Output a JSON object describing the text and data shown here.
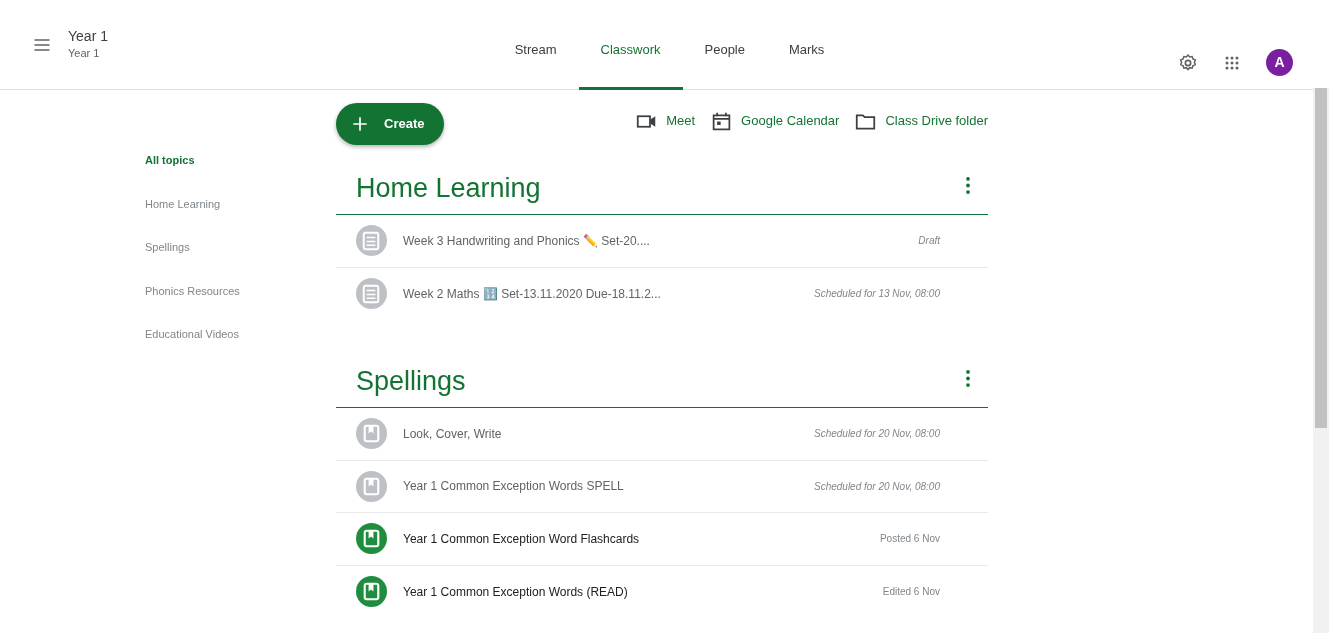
{
  "header": {
    "title": "Year 1",
    "subtitle": "Year 1"
  },
  "tabs": [
    {
      "label": "Stream",
      "selected": false
    },
    {
      "label": "Classwork",
      "selected": true
    },
    {
      "label": "People",
      "selected": false
    },
    {
      "label": "Marks",
      "selected": false
    }
  ],
  "avatar": {
    "initial": "A"
  },
  "create_button": {
    "label": "Create"
  },
  "links": [
    {
      "kind": "video",
      "label": "Meet"
    },
    {
      "kind": "calendar",
      "label": "Google Calendar"
    },
    {
      "kind": "folder",
      "label": "Class Drive folder"
    }
  ],
  "sidebar": {
    "items": [
      {
        "label": "All topics",
        "selected": true
      },
      {
        "label": "Home Learning",
        "selected": false
      },
      {
        "label": "Spellings",
        "selected": false
      },
      {
        "label": "Phonics Resources",
        "selected": false
      },
      {
        "label": "Educational Videos",
        "selected": false
      }
    ]
  },
  "topics": [
    {
      "title": "Home Learning",
      "items": [
        {
          "kind": "assignment",
          "title": "Week 3 Handwriting and Phonics ✏️ Set-20....",
          "status": "Draft",
          "posted": false
        },
        {
          "kind": "assignment",
          "title": "Week 2 Maths 🔢 Set-13.11.2020 Due-18.11.2...",
          "status": "Scheduled for 13 Nov, 08:00",
          "posted": false
        }
      ]
    },
    {
      "title": "Spellings",
      "items": [
        {
          "kind": "material",
          "title": "Look, Cover, Write",
          "status": "Scheduled for 20 Nov, 08:00",
          "posted": false
        },
        {
          "kind": "material",
          "title": "Year 1 Common Exception Words SPELL",
          "status": "Scheduled for 20 Nov, 08:00",
          "posted": false
        },
        {
          "kind": "material",
          "title": "Year 1 Common Exception Word Flashcards",
          "status": "Posted 6 Nov",
          "posted": true
        },
        {
          "kind": "material",
          "title": "Year 1 Common Exception Words (READ)",
          "status": "Edited 6 Nov",
          "posted": true
        }
      ]
    }
  ]
}
